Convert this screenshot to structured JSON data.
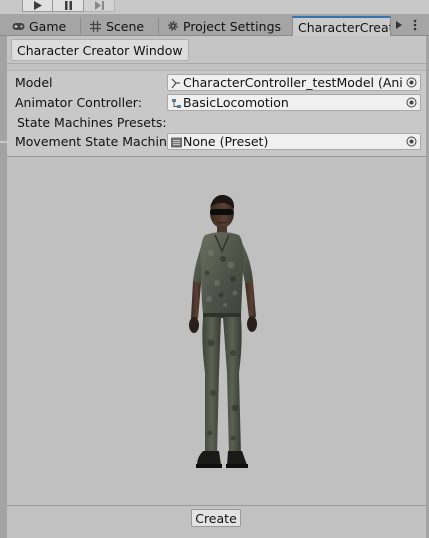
{
  "tabs": [
    {
      "label": "Game",
      "icon": "gamepad-icon"
    },
    {
      "label": "Scene",
      "icon": "scene-grid-icon"
    },
    {
      "label": "Project Settings",
      "icon": "gear-icon"
    },
    {
      "label": "CharacterCreato",
      "active": true
    }
  ],
  "window": {
    "title": "Character Creator Window"
  },
  "fields": [
    {
      "label": "Model",
      "value": "CharacterController_testModel (Animato",
      "icon": "model-icon"
    },
    {
      "label": "Animator Controller:",
      "value": "BasicLocomotion",
      "icon": "animator-controller-icon"
    },
    {
      "label": "State Machines Presets:"
    },
    {
      "label": "Movement State Machine",
      "value": "None (Preset)",
      "icon": "preset-icon"
    }
  ],
  "footer": {
    "create_label": "Create"
  },
  "colors": {
    "active_tab_accent": "#3a72b0",
    "panel_bg": "#c8c8c8",
    "field_bg": "#f0f0f0",
    "preview_bg": "#c0c0c0"
  }
}
